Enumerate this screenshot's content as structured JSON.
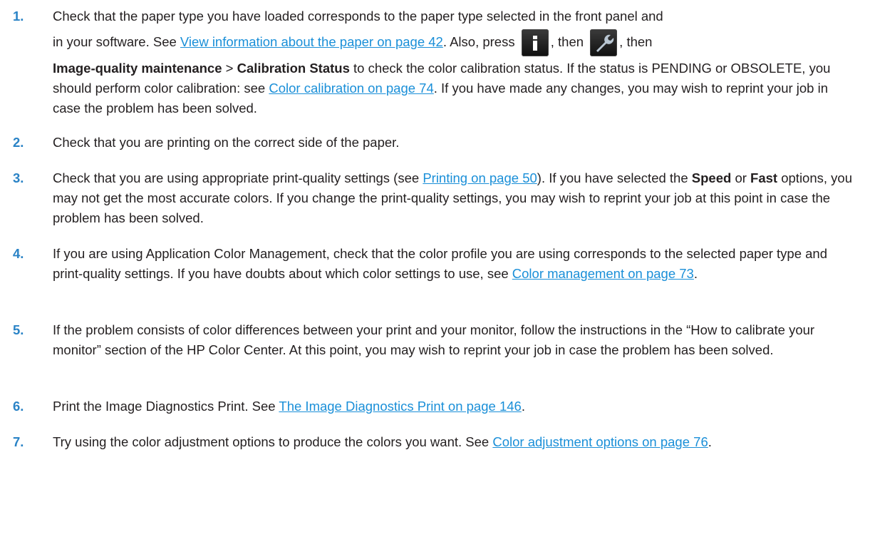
{
  "steps": [
    {
      "number": "1.",
      "p1": "Check that the paper type you have loaded corresponds to the paper type selected in the front panel and",
      "p2": "in your software. See ",
      "link1": "View information about the paper on page 42",
      "p3": ". Also, press ",
      "p4": ", then ",
      "p5": ", then",
      "bold1": "Image-quality maintenance",
      "p6": " > ",
      "bold2": "Calibration Status",
      "p7": " to check the color calibration status. If the status is PENDING or OBSOLETE, you should perform color calibration: see ",
      "link2": "Color calibration on page 74",
      "p8": ". If you have made any changes, you may wish to reprint your job in case the problem has been solved.",
      "icon1": "info-icon",
      "icon2": "wrench-icon"
    },
    {
      "number": "2.",
      "text": "Check that you are printing on the correct side of the paper."
    },
    {
      "number": "3.",
      "p1": "Check that you are using appropriate print-quality settings (see ",
      "link": "Printing on page 50",
      "p2": "). If you have selected the ",
      "bold1": "Speed",
      "p3": " or ",
      "bold2": "Fast",
      "p4": " options, you may not get the most accurate colors. If you change the print-quality settings, you may wish to reprint your job at this point in case the problem has been solved."
    },
    {
      "number": "4.",
      "p1": "If you are using Application Color Management, check that the color profile you are using corresponds to the selected paper type and print-quality settings. If you have doubts about which color settings to use, see ",
      "link": "Color management on page 73",
      "p2": "."
    },
    {
      "number": "5.",
      "text": "If the problem consists of color differences between your print and your monitor, follow the instructions in the “How to calibrate your monitor” section of the HP Color Center. At this point, you may wish to reprint your job in case the problem has been solved."
    },
    {
      "number": "6.",
      "p1": "Print the Image Diagnostics Print. See ",
      "link": "The Image Diagnostics Print on page 146",
      "p2": "."
    },
    {
      "number": "7.",
      "p1": "Try using the color adjustment options to produce the colors you want. See ",
      "link": "Color adjustment options on page 76",
      "p2": "."
    }
  ],
  "colors": {
    "number": "#2a83c6",
    "link": "#1a8fd8",
    "text": "#231f20"
  }
}
